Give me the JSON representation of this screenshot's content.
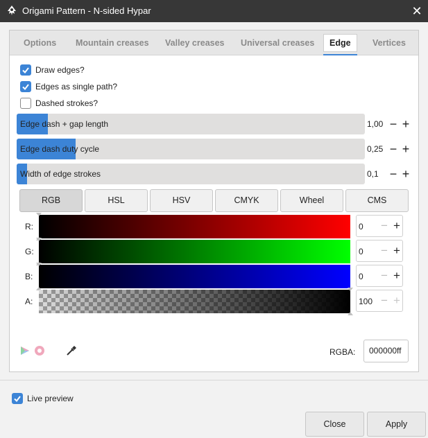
{
  "window": {
    "title": "Origami Pattern - N-sided Hypar",
    "close_glyph": "✕"
  },
  "tabs": [
    {
      "label": "Options"
    },
    {
      "label": "Mountain creases"
    },
    {
      "label": "Valley creases"
    },
    {
      "label": "Universal creases"
    },
    {
      "label": "Edge",
      "active": true
    },
    {
      "label": "Vertices"
    }
  ],
  "checkboxes": [
    {
      "label": "Draw edges?",
      "checked": true
    },
    {
      "label": "Edges as single path?",
      "checked": true
    },
    {
      "label": "Dashed strokes?",
      "checked": false
    }
  ],
  "sliders": [
    {
      "label": "Edge dash + gap length",
      "value": "1,00",
      "fill_fraction": 0.09
    },
    {
      "label": "Edge dash duty cycle",
      "value": "0,25",
      "fill_fraction": 0.17
    },
    {
      "label": "Width of edge strokes",
      "value": "0,1",
      "fill_fraction": 0.03
    }
  ],
  "stepper": {
    "minus": "−",
    "plus": "+"
  },
  "color_modes": [
    {
      "label": "RGB",
      "active": true
    },
    {
      "label": "HSL"
    },
    {
      "label": "HSV"
    },
    {
      "label": "CMYK"
    },
    {
      "label": "Wheel"
    },
    {
      "label": "CMS"
    }
  ],
  "channels": [
    {
      "label": "R:",
      "value": "0",
      "color": "#ff0000"
    },
    {
      "label": "G:",
      "value": "0",
      "color": "#00ff00"
    },
    {
      "label": "B:",
      "value": "0",
      "color": "#0000ff"
    },
    {
      "label": "A:",
      "value": "100",
      "color": "#000000"
    }
  ],
  "icons": {
    "color_managed": "color-managed-icon",
    "out_of_gamut": "out-of-gamut-icon",
    "picker": "eyedropper-icon"
  },
  "rgba": {
    "label": "RGBA:",
    "value": "000000ff"
  },
  "live_preview": {
    "label": "Live preview",
    "checked": true
  },
  "buttons": {
    "close": "Close",
    "apply": "Apply"
  },
  "colors": {
    "accent": "#3c84d6",
    "titlebar": "#373737"
  }
}
